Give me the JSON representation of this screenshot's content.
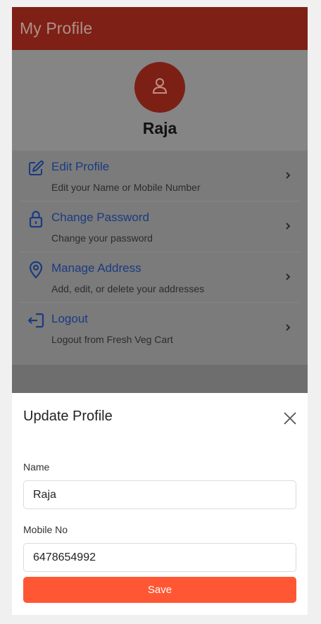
{
  "appbar": {
    "title": "My Profile"
  },
  "profile": {
    "name": "Raja",
    "avatar_icon": "user-icon"
  },
  "menu": {
    "items": [
      {
        "icon": "edit-icon",
        "title": "Edit Profile",
        "subtitle": "Edit your Name or Mobile Number"
      },
      {
        "icon": "lock-icon",
        "title": "Change Password",
        "subtitle": "Change your password"
      },
      {
        "icon": "location-pin-icon",
        "title": "Manage Address",
        "subtitle": "Add, edit, or delete your addresses"
      },
      {
        "icon": "logout-icon",
        "title": "Logout",
        "subtitle": "Logout from Fresh Veg Cart"
      }
    ]
  },
  "sheet": {
    "title": "Update Profile",
    "name_label": "Name",
    "name_value": "Raja",
    "mobile_label": "Mobile No",
    "mobile_value": "6478654992",
    "save_label": "Save"
  },
  "colors": {
    "appbar": "#7e2015",
    "accent": "#ff5733",
    "link": "#1a3b82",
    "avatar": "#7c2015"
  }
}
